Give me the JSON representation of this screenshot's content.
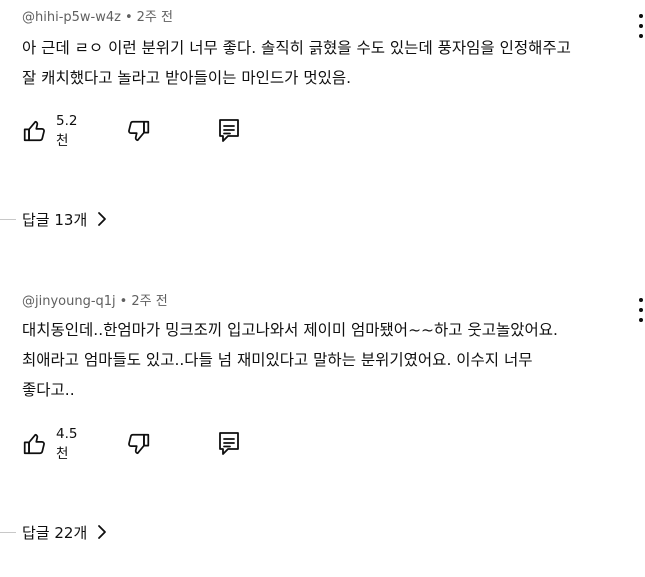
{
  "comments": [
    {
      "handle": "@hihi-p5w-w4z",
      "time": "2주 전",
      "lines": [
        "아 근데 ㄹㅇ 이런 분위기 너무 좋다. 솔직히 긁혔을 수도 있는데 풍자임을 인정해주고",
        "잘 캐치했다고 놀라고 받아들이는 마인드가 멋있음."
      ],
      "likes": "5.2천",
      "replies": "답글 13개"
    },
    {
      "handle": "@jinyoung-q1j",
      "time": "2주 전",
      "lines": [
        "대치동인데..한엄마가 밍크조끼 입고나와서 제이미 엄마됐어~~하고 웃고놀았어요.",
        "최애라고 엄마들도 있고..다들 넘 재미있다고 말하는 분위기였어요. 이수지 너무",
        "좋다고.."
      ],
      "likes": "4.5천",
      "replies": "답글 22개"
    }
  ],
  "icons": {
    "like": "thumbs-up-icon",
    "dislike": "thumbs-down-icon",
    "reply": "comment-icon",
    "more": "more-vertical-icon",
    "chevron": "chevron-right-icon"
  }
}
